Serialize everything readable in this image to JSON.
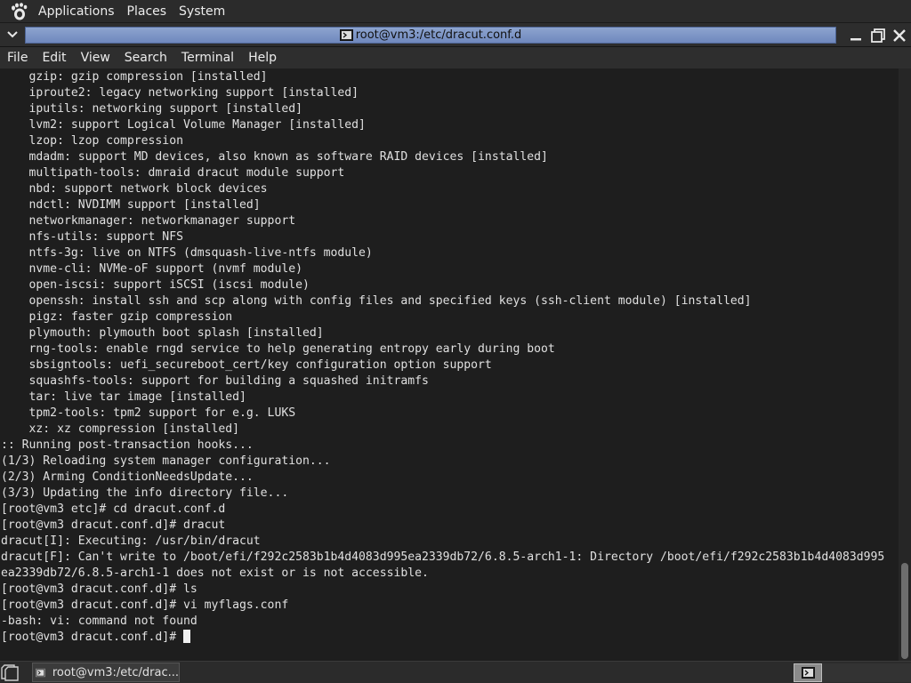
{
  "panel": {
    "menus": [
      "Applications",
      "Places",
      "System"
    ]
  },
  "window": {
    "title": "root@vm3:/etc/dracut.conf.d"
  },
  "menubar": {
    "items": [
      "File",
      "Edit",
      "View",
      "Search",
      "Terminal",
      "Help"
    ]
  },
  "terminal": {
    "lines": [
      "    gzip: gzip compression [installed]",
      "    iproute2: legacy networking support [installed]",
      "    iputils: networking support [installed]",
      "    lvm2: support Logical Volume Manager [installed]",
      "    lzop: lzop compression",
      "    mdadm: support MD devices, also known as software RAID devices [installed]",
      "    multipath-tools: dmraid dracut module support",
      "    nbd: support network block devices",
      "    ndctl: NVDIMM support [installed]",
      "    networkmanager: networkmanager support",
      "    nfs-utils: support NFS",
      "    ntfs-3g: live on NTFS (dmsquash-live-ntfs module)",
      "    nvme-cli: NVMe-oF support (nvmf module)",
      "    open-iscsi: support iSCSI (iscsi module)",
      "    openssh: install ssh and scp along with config files and specified keys (ssh-client module) [installed]",
      "    pigz: faster gzip compression",
      "    plymouth: plymouth boot splash [installed]",
      "    rng-tools: enable rngd service to help generating entropy early during boot",
      "    sbsigntools: uefi_secureboot_cert/key configuration option support",
      "    squashfs-tools: support for building a squashed initramfs",
      "    tar: live tar image [installed]",
      "    tpm2-tools: tpm2 support for e.g. LUKS",
      "    xz: xz compression [installed]",
      ":: Running post-transaction hooks...",
      "(1/3) Reloading system manager configuration...",
      "(2/3) Arming ConditionNeedsUpdate...",
      "(3/3) Updating the info directory file...",
      "[root@vm3 etc]# cd dracut.conf.d",
      "[root@vm3 dracut.conf.d]# dracut",
      "dracut[I]: Executing: /usr/bin/dracut",
      "dracut[F]: Can't write to /boot/efi/f292c2583b1b4d4083d995ea2339db72/6.8.5-arch1-1: Directory /boot/efi/f292c2583b1b4d4083d995",
      "ea2339db72/6.8.5-arch1-1 does not exist or is not accessible.",
      "[root@vm3 dracut.conf.d]# ls",
      "[root@vm3 dracut.conf.d]# vi myflags.conf",
      "-bash: vi: command not found",
      "[root@vm3 dracut.conf.d]# "
    ]
  },
  "taskbar": {
    "task_label": "root@vm3:/etc/drac..."
  },
  "icons": {
    "panel_logo": "gnome-foot-icon",
    "terminal": "terminal-icon",
    "show_desktop": "show-desktop-icon"
  }
}
